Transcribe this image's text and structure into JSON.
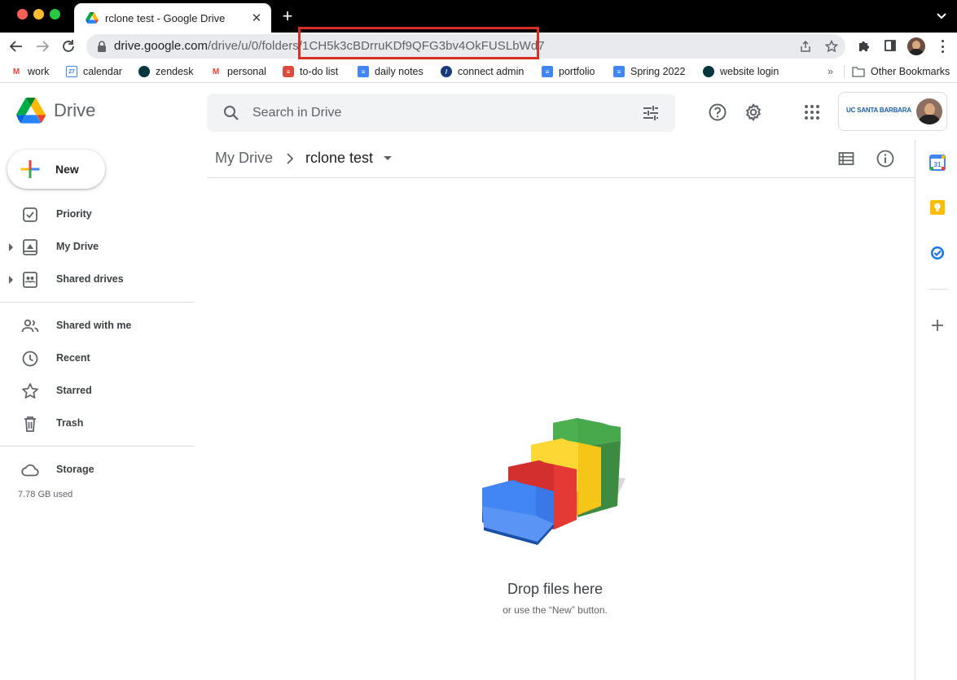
{
  "browser": {
    "tab_title": "rclone test - Google Drive",
    "url_host": "drive.google.com",
    "url_path": "/drive/u/0/folders/",
    "url_id": "1CH5k3cBDrruKDf9QFG3bv4OkFUSLbWd7",
    "bookmarks": [
      {
        "label": "work",
        "icon": "gmail-icon"
      },
      {
        "label": "calendar",
        "icon": "calendar-icon"
      },
      {
        "label": "zendesk",
        "icon": "zendesk-icon"
      },
      {
        "label": "personal",
        "icon": "gmail-icon"
      },
      {
        "label": "to-do list",
        "icon": "todoist-icon"
      },
      {
        "label": "daily notes",
        "icon": "docs-icon"
      },
      {
        "label": "connect admin",
        "icon": "compass-icon"
      },
      {
        "label": "portfolio",
        "icon": "docs-icon"
      },
      {
        "label": "Spring 2022",
        "icon": "docs-icon"
      },
      {
        "label": "website login",
        "icon": "zendesk-icon"
      }
    ],
    "other_bookmarks": "Other Bookmarks",
    "overflow": "»"
  },
  "drive": {
    "brand": "Drive",
    "search_placeholder": "Search in Drive",
    "org": "UC SANTA BARBARA"
  },
  "sidebar": {
    "new_label": "New",
    "items": [
      {
        "label": "Priority"
      },
      {
        "label": "My Drive"
      },
      {
        "label": "Shared drives"
      },
      {
        "label": "Shared with me"
      },
      {
        "label": "Recent"
      },
      {
        "label": "Starred"
      },
      {
        "label": "Trash"
      },
      {
        "label": "Storage"
      }
    ],
    "storage_used": "7.78 GB used"
  },
  "main": {
    "breadcrumb_root": "My Drive",
    "breadcrumb_current": "rclone test",
    "empty_title": "Drop files here",
    "empty_subtitle": "or use the “New” button."
  },
  "colors": {
    "highlight": "#d93025",
    "drive_blue": "#4285f4",
    "drive_green": "#0f9d58",
    "drive_yellow": "#f4b400",
    "drive_red": "#db4437"
  }
}
